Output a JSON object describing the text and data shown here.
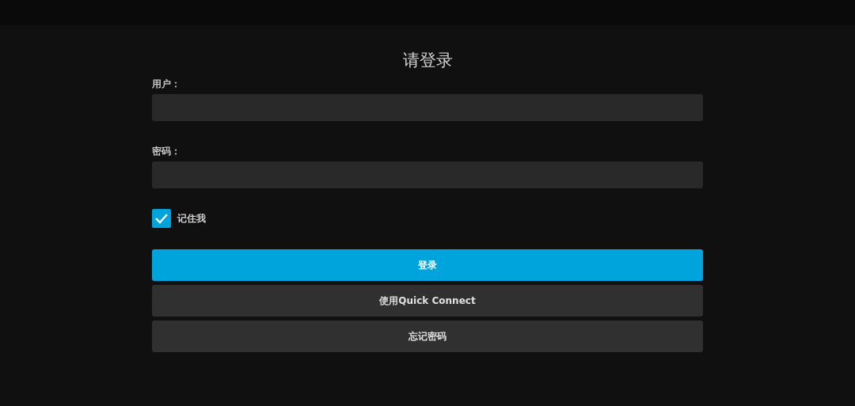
{
  "title": "请登录",
  "fields": [
    {
      "label": "用户："
    },
    {
      "label": "密码："
    }
  ],
  "remember": {
    "label": "记住我",
    "checked": true
  },
  "buttons": [
    {
      "label": "登录",
      "kind": "primary"
    },
    {
      "label": "使用Quick Connect",
      "kind": "secondary"
    },
    {
      "label": "忘记密码",
      "kind": "secondary"
    }
  ]
}
